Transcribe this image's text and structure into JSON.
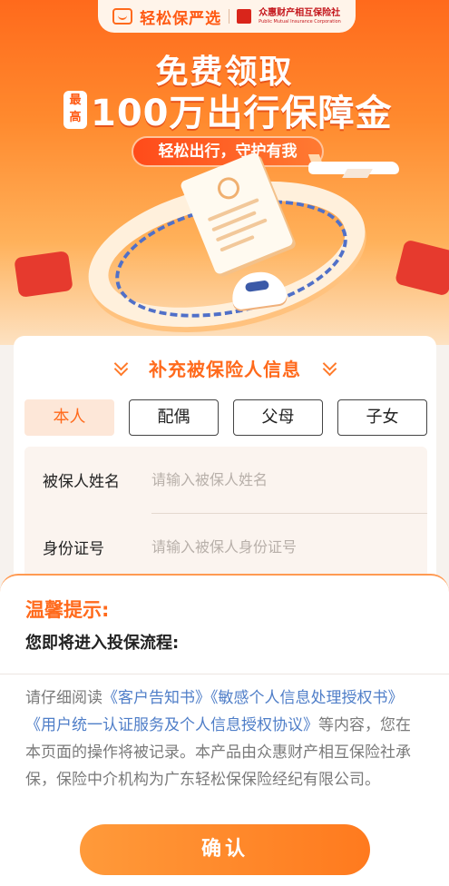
{
  "brand": {
    "name": "轻松保严选",
    "partner_cn": "众惠财产相互保险社",
    "partner_en": "Public Mutual Insurance Corporation"
  },
  "hero": {
    "title": "免费领取",
    "max_badge": "最高",
    "amount": "100万出行保障金",
    "tagline": "轻松出行，守护有我"
  },
  "form": {
    "title": "补充被保险人信息",
    "relations": [
      "本人",
      "配偶",
      "父母",
      "子女"
    ],
    "active_relation": "本人",
    "fields": [
      {
        "label": "被保人姓名",
        "placeholder": "请输入被保人姓名",
        "value": ""
      },
      {
        "label": "身份证号",
        "placeholder": "请输入被保人身份证号",
        "value": ""
      }
    ]
  },
  "notice": {
    "title": "温馨提示:",
    "subtitle": "您即将进入投保流程:",
    "text_intro": "请仔细阅读",
    "link1": "《客户告知书》",
    "link2": "《敏感个人信息处理授权书》",
    "link3": "《用户统一认证服务及个人信息授权协议》",
    "text_rest": "等内容，您在本页面的操作将被记录。本产品由众惠财产相互保险社承保，保险中介机构为广东轻松保保险经纪有限公司。",
    "confirm_label": "确认"
  },
  "colors": {
    "accent": "#ff6a1c",
    "link": "#4f7ec8",
    "active_tab_bg": "#fde7d8"
  }
}
